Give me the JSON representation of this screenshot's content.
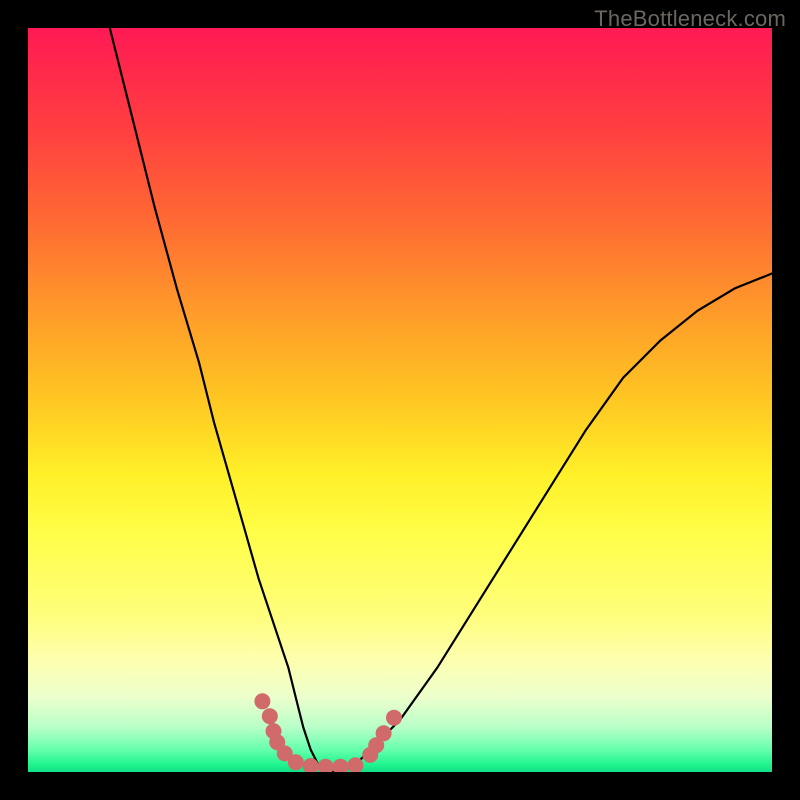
{
  "watermark": "TheBottleneck.com",
  "chart_data": {
    "type": "line",
    "title": "",
    "xlabel": "",
    "ylabel": "",
    "xlim": [
      0,
      100
    ],
    "ylim": [
      0,
      100
    ],
    "series": [
      {
        "name": "bottleneck-curve",
        "x": [
          11,
          14,
          17,
          20,
          23,
          25,
          27,
          29,
          31,
          33,
          35,
          36,
          37,
          38,
          39,
          40,
          42,
          44,
          46,
          50,
          55,
          60,
          65,
          70,
          75,
          80,
          85,
          90,
          95,
          100
        ],
        "y": [
          100,
          88,
          76,
          65,
          55,
          47,
          40,
          33,
          26,
          20,
          14,
          10,
          6,
          3,
          1,
          0,
          0,
          1,
          3,
          7,
          14,
          22,
          30,
          38,
          46,
          53,
          58,
          62,
          65,
          67
        ]
      }
    ],
    "markers": {
      "name": "highlight-dots",
      "color": "#d16a6a",
      "points": [
        {
          "x": 31.5,
          "y": 9.5
        },
        {
          "x": 32.5,
          "y": 7.5
        },
        {
          "x": 33.0,
          "y": 5.5
        },
        {
          "x": 33.5,
          "y": 4.0
        },
        {
          "x": 34.5,
          "y": 2.5
        },
        {
          "x": 36.0,
          "y": 1.3
        },
        {
          "x": 38.0,
          "y": 0.8
        },
        {
          "x": 40.0,
          "y": 0.7
        },
        {
          "x": 42.0,
          "y": 0.7
        },
        {
          "x": 44.0,
          "y": 0.9
        },
        {
          "x": 46.0,
          "y": 2.3
        },
        {
          "x": 46.8,
          "y": 3.6
        },
        {
          "x": 47.8,
          "y": 5.2
        },
        {
          "x": 49.2,
          "y": 7.3
        }
      ]
    }
  },
  "colors": {
    "curve": "#000000",
    "marker": "#d16a6a",
    "frame": "#000000"
  }
}
